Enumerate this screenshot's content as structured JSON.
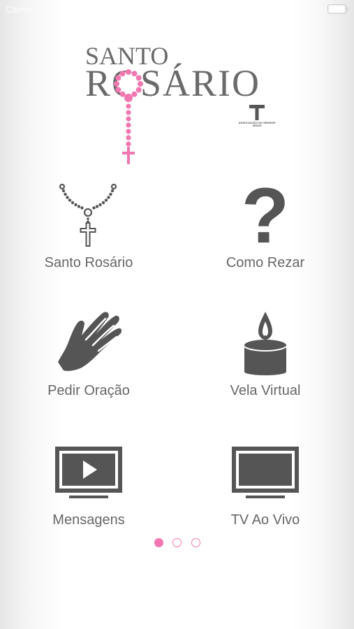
{
  "status_bar": {
    "carrier": "Carrier",
    "battery_icon": "battery-icon"
  },
  "logo": {
    "line1": "SANTO",
    "line2": "ROSÁRIO",
    "org_text": "ASSOCIAÇÃO DO SENHOR JESUS"
  },
  "menu": {
    "items": [
      {
        "label": "Santo Rosário",
        "icon": "rosary-icon"
      },
      {
        "label": "Como Rezar",
        "icon": "question-mark-icon"
      },
      {
        "label": "Pedir Oração",
        "icon": "praying-hands-icon"
      },
      {
        "label": "Vela Virtual",
        "icon": "candle-icon"
      },
      {
        "label": "Mensagens",
        "icon": "tv-play-icon"
      },
      {
        "label": "TV Ao Vivo",
        "icon": "tv-icon"
      }
    ]
  },
  "pager": {
    "pages": 3,
    "current": 1
  },
  "colors": {
    "accent": "#f277b1",
    "icon_gray": "#555555",
    "text_gray": "#666666"
  }
}
